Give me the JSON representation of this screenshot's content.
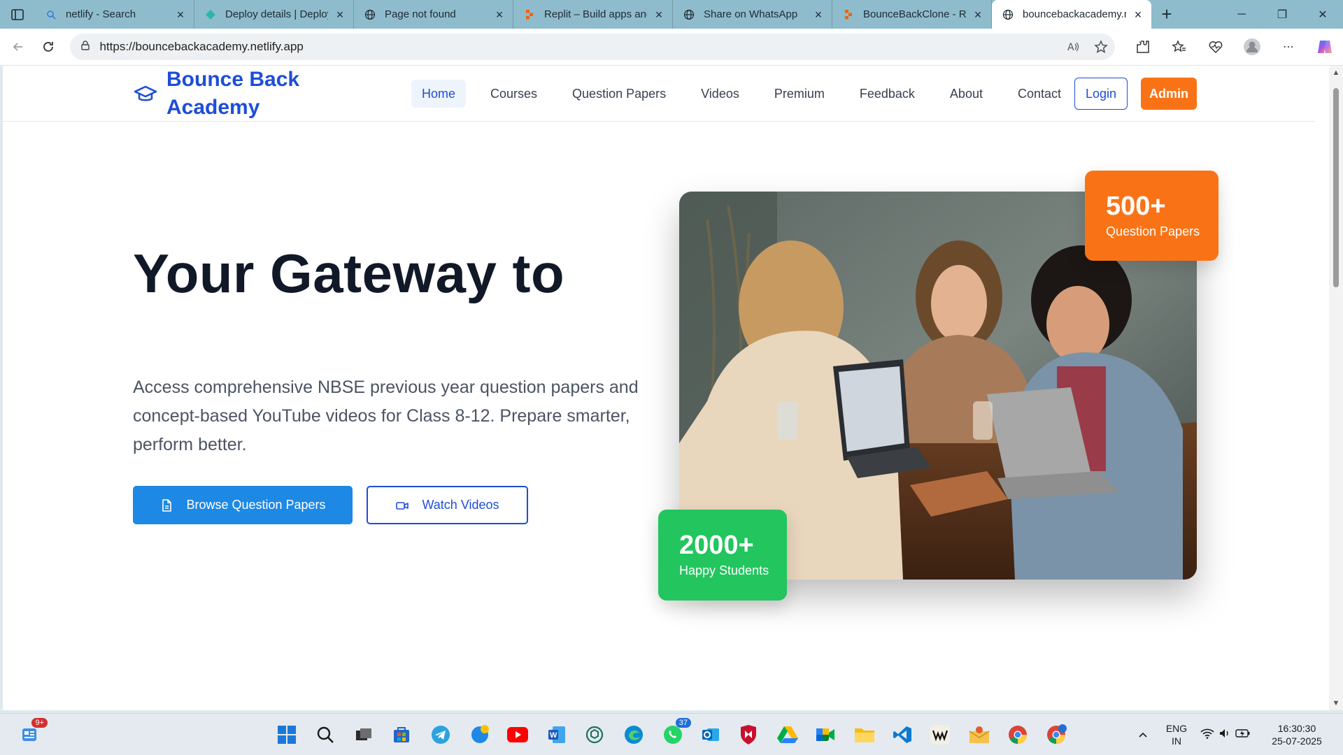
{
  "browser": {
    "tabs": [
      {
        "title": "netlify - Search",
        "icon": "search-icon"
      },
      {
        "title": "Deploy details | Deploy",
        "icon": "netlify-icon"
      },
      {
        "title": "Page not found",
        "icon": "globe-icon"
      },
      {
        "title": "Replit – Build apps and",
        "icon": "replit-icon"
      },
      {
        "title": "Share on WhatsApp",
        "icon": "globe-icon"
      },
      {
        "title": "BounceBackClone - Re",
        "icon": "replit-icon"
      },
      {
        "title": "bouncebackacademy.n",
        "icon": "globe-icon",
        "active": true
      }
    ],
    "url": "https://bouncebackacademy.netlify.app"
  },
  "site": {
    "logo_text": "Bounce Back Academy",
    "nav": [
      "Home",
      "Courses",
      "Question Papers",
      "Videos",
      "Premium",
      "Feedback",
      "About",
      "Contact"
    ],
    "login_label": "Login",
    "admin_label": "Admin",
    "accent_blue": "#1d4ed8",
    "accent_orange": "#f97316",
    "accent_green": "#22c55e"
  },
  "hero": {
    "title": "Your Gateway to",
    "description": "Access comprehensive NBSE previous year question papers and concept-based YouTube videos for Class 8-12. Prepare smarter, perform better.",
    "primary_button": "Browse Question Papers",
    "secondary_button": "Watch Videos",
    "stat_papers_value": "500+",
    "stat_papers_label": "Question Papers",
    "stat_students_value": "2000+",
    "stat_students_label": "Happy Students"
  },
  "taskbar": {
    "notification_badge": "9+",
    "whatsapp_badge": "37",
    "language": "ENG",
    "region": "IN",
    "time": "16:30:30",
    "date": "25-07-2025"
  }
}
